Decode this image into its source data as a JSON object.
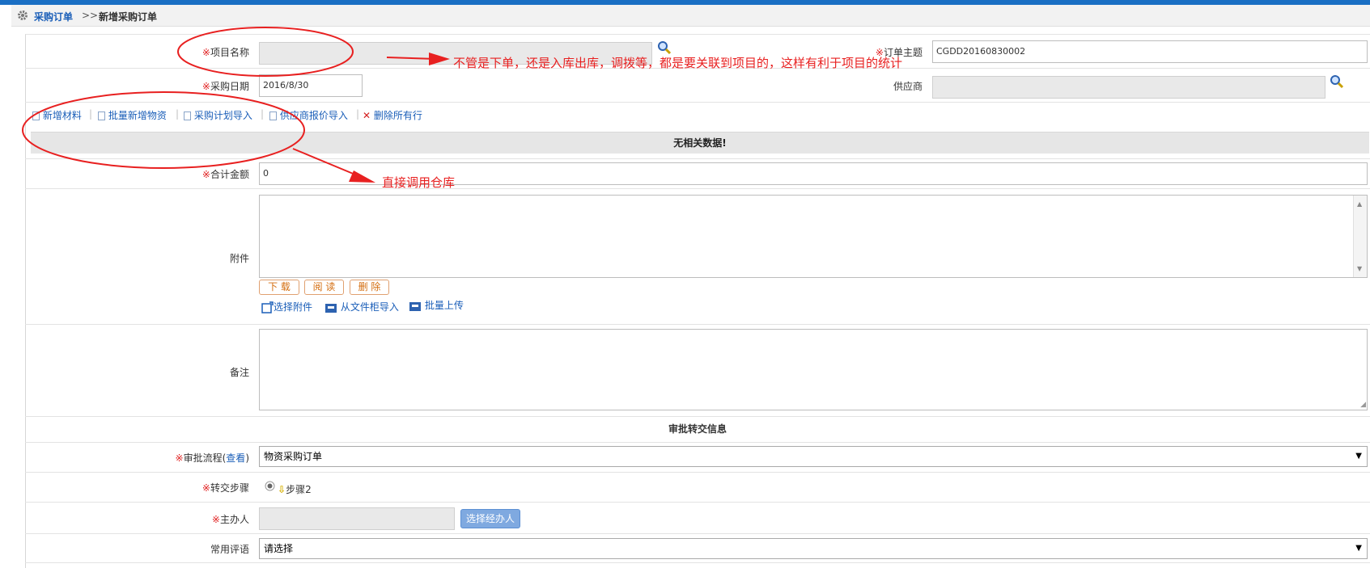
{
  "breadcrumb": {
    "root": "采购订单",
    "separator": ">>",
    "current": "新增采购订单"
  },
  "form": {
    "project_label": "项目名称",
    "subject_label": "订单主题",
    "subject_value": "CGDD20160830002",
    "date_label": "采购日期",
    "date_value": "2016/8/30",
    "supplier_label": "供应商",
    "required_mark": "※"
  },
  "toolbar": {
    "add_material": "新增材料",
    "batch_add": "批量新增物资",
    "plan_import": "采购计划导入",
    "quote_import": "供应商报价导入",
    "delete_all": "删除所有行",
    "separator": "|"
  },
  "table": {
    "empty_text": "无相关数据!"
  },
  "total": {
    "label": "合计金额",
    "value": "0"
  },
  "attachment": {
    "label": "附件",
    "download": "下 载",
    "read": "阅 读",
    "delete": "删 除",
    "select": "选择附件",
    "import_cabinet": "从文件柜导入",
    "batch_upload": "批量上传"
  },
  "remark": {
    "label": "备注"
  },
  "approval": {
    "section_title": "审批转交信息",
    "flow_label": "审批流程",
    "flow_view": "查看",
    "flow_paren_open": "(",
    "flow_paren_close": ")",
    "flow_value": "物资采购订单",
    "step_label": "转交步骤",
    "step_value": "步骤2",
    "handler_label": "主办人",
    "handler_button": "选择经办人",
    "comment_label": "常用评语",
    "comment_value": "请选择"
  },
  "annotations": {
    "note1": "不管是下单，还是入库出库，调拨等，都是要关联到项目的，这样有利于项目的统计",
    "note2": "直接调用仓库"
  },
  "colors": {
    "required": "#e02020",
    "link": "#1a5eb8",
    "annotation": "#e82020",
    "topbar": "#1a6fc4"
  }
}
